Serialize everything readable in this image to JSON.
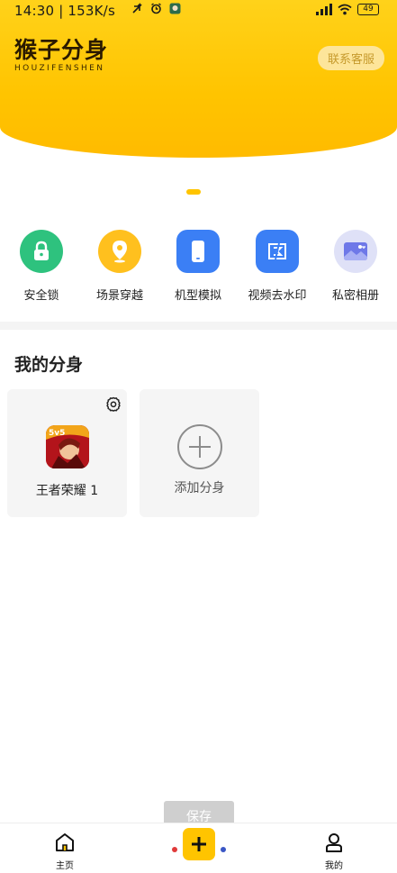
{
  "status_bar": {
    "time": "14:30 | 153K/s",
    "battery": "49"
  },
  "brand": {
    "title": "猴子分身",
    "subtitle": "HOUZIFENSHEN",
    "service_button": "联系客服"
  },
  "features": [
    {
      "label": "安全锁",
      "icon": "lock-icon",
      "color": "#2ec27e"
    },
    {
      "label": "场景穿越",
      "icon": "location-pin-icon",
      "color": "#ffc01e"
    },
    {
      "label": "机型模拟",
      "icon": "phone-icon",
      "color": "#3b7ff5"
    },
    {
      "label": "视频去水印",
      "icon": "watermark-icon",
      "color": "#3b7ff5"
    },
    {
      "label": "私密相册",
      "icon": "album-icon",
      "color": "#dfe1f7"
    }
  ],
  "clones": {
    "title": "我的分身",
    "items": [
      {
        "label": "王者荣耀  1",
        "icon": "honor-of-kings-app-icon"
      }
    ],
    "add_label": "添加分身"
  },
  "toast": "保存",
  "tabbar": {
    "home": "主页",
    "mine": "我的"
  }
}
